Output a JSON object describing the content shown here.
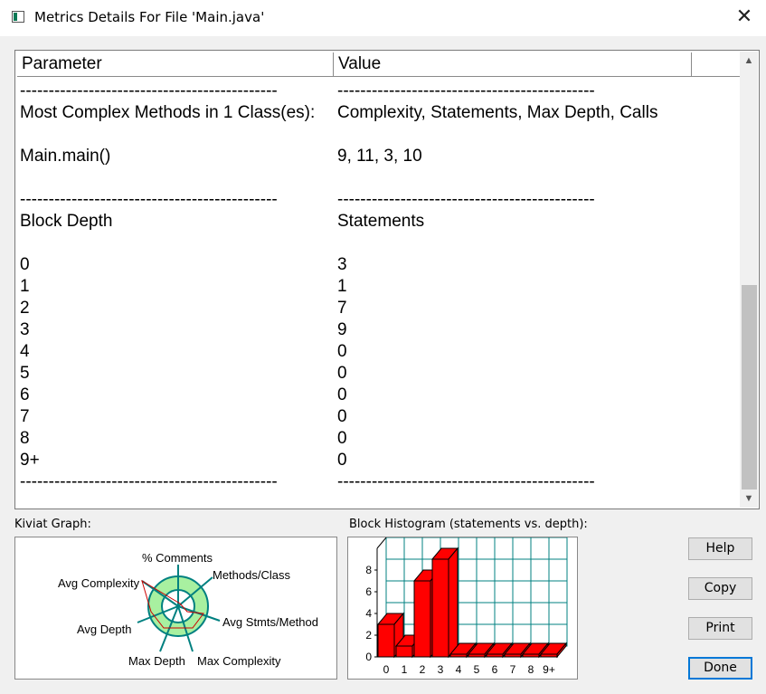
{
  "window": {
    "title": "Metrics Details For File 'Main.java'",
    "close_glyph": "✕"
  },
  "table": {
    "columns": [
      "Parameter",
      "Value"
    ],
    "rows": [
      {
        "param": "---------------------------------------------",
        "value": "---------------------------------------------"
      },
      {
        "param": "Most Complex Methods in 1 Class(es):",
        "value": "Complexity, Statements, Max Depth, Calls"
      },
      {
        "param": "",
        "value": ""
      },
      {
        "param": "Main.main()",
        "value": "9, 11, 3, 10"
      },
      {
        "param": "",
        "value": ""
      },
      {
        "param": "---------------------------------------------",
        "value": "---------------------------------------------"
      },
      {
        "param": "Block Depth",
        "value": "Statements"
      },
      {
        "param": "",
        "value": ""
      },
      {
        "param": "0",
        "value": "3"
      },
      {
        "param": "1",
        "value": "1"
      },
      {
        "param": "2",
        "value": "7"
      },
      {
        "param": "3",
        "value": "9"
      },
      {
        "param": "4",
        "value": "0"
      },
      {
        "param": "5",
        "value": "0"
      },
      {
        "param": "6",
        "value": "0"
      },
      {
        "param": "7",
        "value": "0"
      },
      {
        "param": "8",
        "value": "0"
      },
      {
        "param": "9+",
        "value": "0"
      },
      {
        "param": "---------------------------------------------",
        "value": "---------------------------------------------"
      }
    ]
  },
  "kiviat": {
    "label": "Kiviat Graph:",
    "axes": [
      "% Comments",
      "Methods/Class",
      "Avg Stmts/Method",
      "Max Complexity",
      "Max Depth",
      "Avg Depth",
      "Avg Complexity"
    ]
  },
  "histogram": {
    "label": "Block Histogram (statements vs. depth):",
    "y_ticks": [
      "0",
      "2",
      "4",
      "6",
      "8"
    ],
    "categories": [
      "0",
      "1",
      "2",
      "3",
      "4",
      "5",
      "6",
      "7",
      "8",
      "9+"
    ],
    "values": [
      3,
      1,
      7,
      9,
      0,
      0,
      0,
      0,
      0,
      0
    ],
    "ylim": [
      0,
      10
    ],
    "bar_color": "#ff0000",
    "grid_color": "#008080"
  },
  "buttons": {
    "help": "Help",
    "copy": "Copy",
    "print": "Print",
    "done": "Done"
  },
  "colors": {
    "kiviat_ring": "#a8f0a0",
    "kiviat_edge": "#008080",
    "kiviat_line": "#cc0000"
  }
}
